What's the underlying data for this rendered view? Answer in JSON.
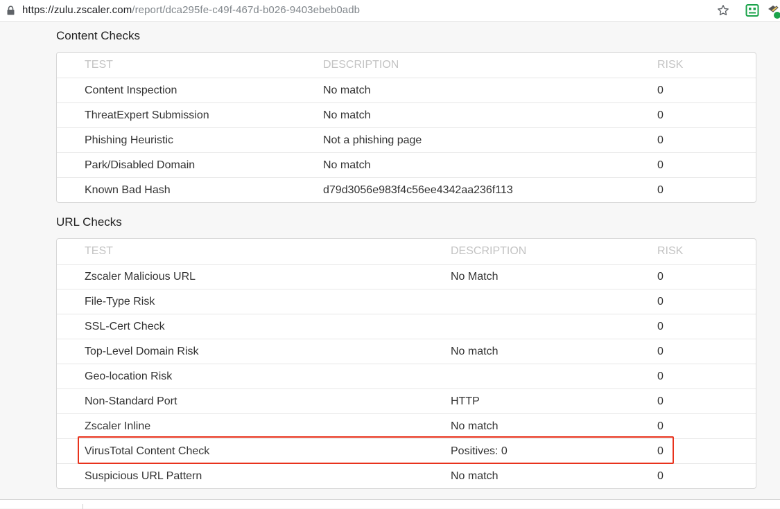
{
  "browser": {
    "url_host": "https://zulu.zscaler.com",
    "url_path": "/report/dca295fe-c49f-467d-b026-9403ebeb0adb"
  },
  "content_checks": {
    "title": "Content Checks",
    "headers": {
      "test": "TEST",
      "description": "DESCRIPTION",
      "risk": "RISK"
    },
    "rows": [
      {
        "test": "Content Inspection",
        "description": "No match",
        "risk": "0"
      },
      {
        "test": "ThreatExpert Submission",
        "description": "No match",
        "risk": "0"
      },
      {
        "test": "Phishing Heuristic",
        "description": "Not a phishing page",
        "risk": "0"
      },
      {
        "test": "Park/Disabled Domain",
        "description": "No match",
        "risk": "0"
      },
      {
        "test": "Known Bad Hash",
        "description": "d79d3056e983f4c56ee4342aa236f113",
        "risk": "0"
      }
    ]
  },
  "url_checks": {
    "title": "URL Checks",
    "headers": {
      "test": "TEST",
      "description": "DESCRIPTION",
      "risk": "RISK"
    },
    "rows": [
      {
        "test": "Zscaler Malicious URL",
        "description": "No Match",
        "risk": "0"
      },
      {
        "test": "File-Type Risk",
        "description": "",
        "risk": "0"
      },
      {
        "test": "SSL-Cert Check",
        "description": "",
        "risk": "0"
      },
      {
        "test": "Top-Level Domain Risk",
        "description": "No match",
        "risk": "0"
      },
      {
        "test": "Geo-location Risk",
        "description": "",
        "risk": "0"
      },
      {
        "test": "Non-Standard Port",
        "description": "HTTP",
        "risk": "0"
      },
      {
        "test": "Zscaler Inline",
        "description": "No match",
        "risk": "0"
      },
      {
        "test": "VirusTotal Content Check",
        "description": "Positives: 0",
        "risk": "0"
      },
      {
        "test": "Suspicious URL Pattern",
        "description": "No match",
        "risk": "0"
      }
    ]
  },
  "colors": {
    "highlight": "#e8321c",
    "header_text": "#c3c3c3",
    "ext_icon": "#1aa34a"
  },
  "icons": {
    "lock": "lock-icon",
    "star": "star-icon",
    "extension": "robot-extension-icon",
    "extension2": "drone-extension-icon"
  }
}
